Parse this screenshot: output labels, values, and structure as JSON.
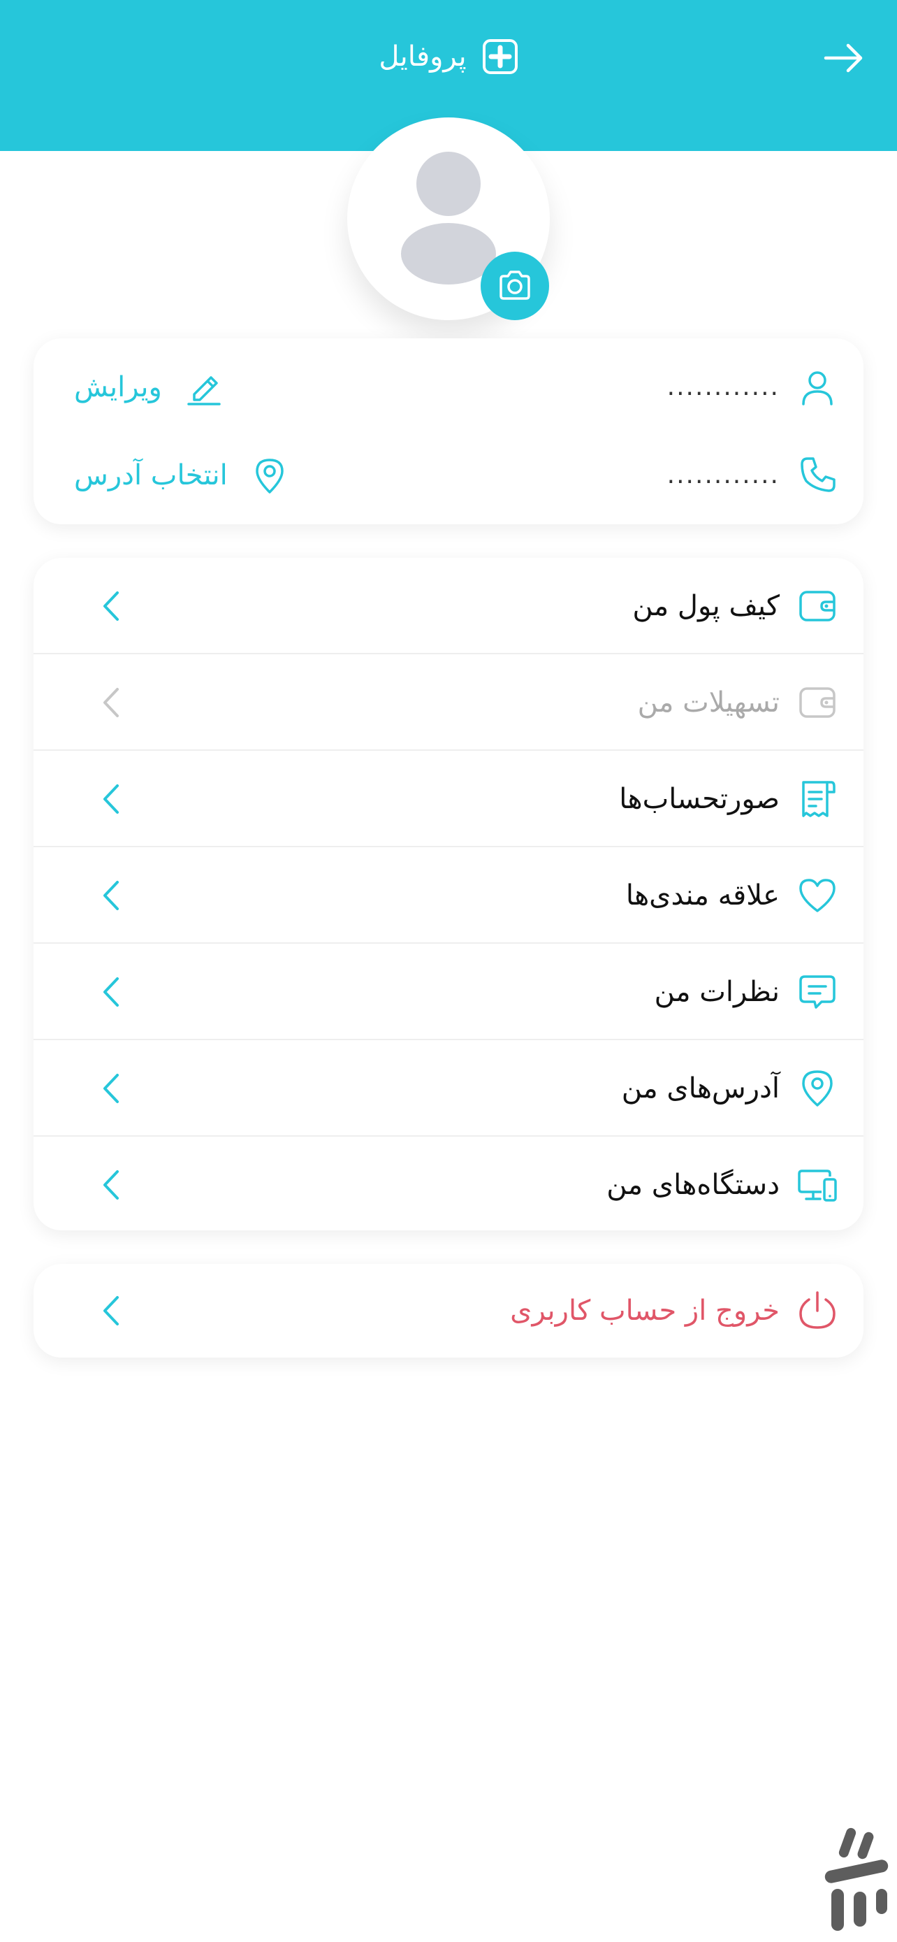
{
  "header": {
    "title": "پروفایل",
    "background": "#26C6DA",
    "logo_icon": "plus-square-icon",
    "back_icon": "arrow-right-icon"
  },
  "avatar": {
    "icon": "user-silhouette-icon",
    "camera_icon": "camera-icon"
  },
  "profile_info": {
    "name_value": "............",
    "phone_value": "............",
    "edit_label": "ویرایش",
    "select_address_label": "انتخاب آدرس"
  },
  "menu": {
    "items": [
      {
        "label": "کیف پول من",
        "icon": "wallet-icon",
        "enabled": true
      },
      {
        "label": "تسهیلات من",
        "icon": "wallet-icon",
        "enabled": false
      },
      {
        "label": "صورتحساب‌ها",
        "icon": "invoice-icon",
        "enabled": true
      },
      {
        "label": "علاقه مندی‌ها",
        "icon": "heart-icon",
        "enabled": true
      },
      {
        "label": "نظرات من",
        "icon": "comment-icon",
        "enabled": true
      },
      {
        "label": "آدرس‌های من",
        "icon": "location-pin-icon",
        "enabled": true
      },
      {
        "label": "دستگاه‌های من",
        "icon": "devices-icon",
        "enabled": true
      }
    ]
  },
  "logout": {
    "label": "خروج از حساب کاربری",
    "icon": "power-icon",
    "color": "#E05668"
  },
  "colors": {
    "accent": "#26C6DA",
    "disabled": "#C7C7C7",
    "danger": "#E05668",
    "text": "#111111"
  }
}
